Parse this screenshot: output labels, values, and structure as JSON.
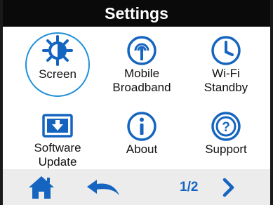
{
  "header": {
    "title": "Settings"
  },
  "menu": {
    "items": [
      {
        "label": "Screen",
        "icon": "brightness-icon",
        "selected": true
      },
      {
        "label": "Mobile\nBroadband",
        "icon": "antenna-icon"
      },
      {
        "label": "Wi-Fi\nStandby",
        "icon": "clock-icon"
      },
      {
        "label": "Software\nUpdate",
        "icon": "download-icon"
      },
      {
        "label": "About",
        "icon": "info-icon"
      },
      {
        "label": "Support",
        "icon": "help-icon"
      }
    ]
  },
  "footer": {
    "page": "1/2"
  },
  "colors": {
    "accent": "#1565c0",
    "selection_ring": "#1e90d8",
    "header_bg": "#0a0a0a",
    "footer_bg": "#ececec"
  }
}
